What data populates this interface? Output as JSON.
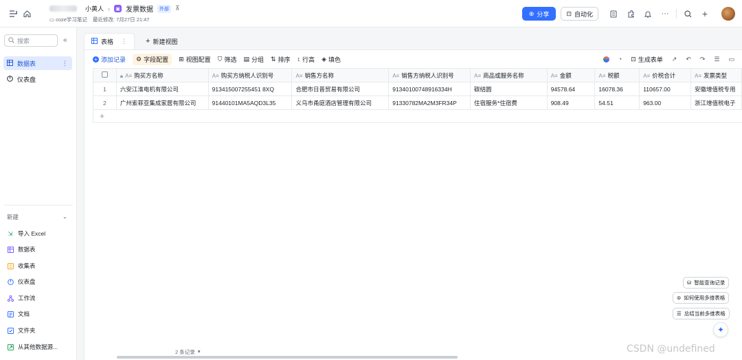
{
  "header": {
    "breadcrumb_parent": "小黄人",
    "doc_title": "发票数据",
    "ext_tag": "外部",
    "space_name": "coze学习笔记",
    "last_modified": "最近修改: 7月27日 21:47",
    "share_label": "分享",
    "automation_label": "自动化"
  },
  "sidebar": {
    "search_placeholder": "搜索",
    "items": [
      {
        "label": "数据表",
        "active": true
      },
      {
        "label": "仪表盘",
        "active": false
      }
    ],
    "new_label": "新建",
    "new_items": [
      {
        "label": "导入 Excel",
        "icon": "excel-icon",
        "color": "#23a55a"
      },
      {
        "label": "数据表",
        "icon": "grid-icon",
        "color": "#7b61ff"
      },
      {
        "label": "收集表",
        "icon": "form-icon",
        "color": "#f5a623"
      },
      {
        "label": "仪表盘",
        "icon": "dashboard-icon",
        "color": "#3370ff"
      },
      {
        "label": "工作流",
        "icon": "workflow-icon",
        "color": "#7b61ff"
      },
      {
        "label": "文档",
        "icon": "doc-icon",
        "color": "#3370ff"
      },
      {
        "label": "文件夹",
        "icon": "folder-icon",
        "color": "#3370ff"
      },
      {
        "label": "从其他数据源...",
        "icon": "datasource-icon",
        "color": "#23a55a"
      }
    ]
  },
  "tabs": {
    "active_tab": "表格",
    "new_view": "新建视图"
  },
  "toolbar": {
    "add_record": "添加记录",
    "field_config": "字段配置",
    "view_config": "视图配置",
    "filter": "筛选",
    "group": "分组",
    "sort": "排序",
    "row_height": "行高",
    "fill_color": "填色",
    "generate_form": "生成表单"
  },
  "table": {
    "columns": [
      "购买方名称",
      "购买方纳税人识别号",
      "销售方名称",
      "销售方纳税人识别号",
      "商品或服务名称",
      "金额",
      "税额",
      "价税合计",
      "发票类型"
    ],
    "rows": [
      [
        "1",
        "六安江淮电机有限公司",
        "913415007255451 8XQ",
        "合肥市日普贸易有限公司",
        "91340100748916334H",
        "碳结圆",
        "94578.64",
        "16078.36",
        "110657.00",
        "安徽增值税专用"
      ],
      [
        "2",
        "广州索菲亚集成家居有限公司",
        "91440101MA5AQD3L35",
        "义乌市甬庭酒店管理有限公司",
        "91330782MA2M3FR34P",
        "住宿服务*住宿费",
        "908.49",
        "54.51",
        "963.00",
        "浙江增值税电子"
      ]
    ]
  },
  "helpers": {
    "smart_query": "智能查询记录",
    "how_to_use": "如何使用多维表格",
    "summarize": "总结当前多维表格"
  },
  "footer": {
    "record_count": "2 条记录"
  },
  "watermark": "CSDN @undefined"
}
